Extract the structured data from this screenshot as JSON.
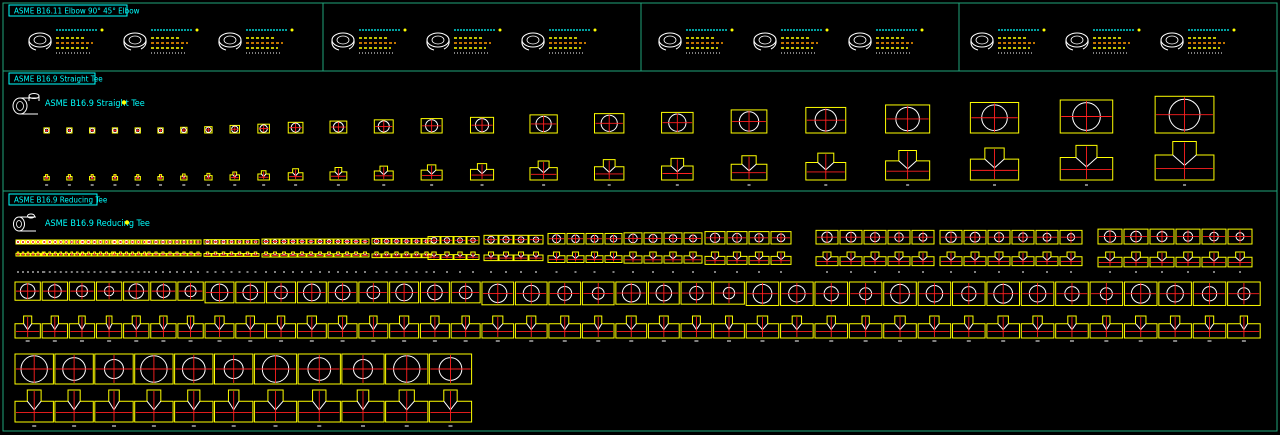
{
  "colors": {
    "background": "#000000",
    "frame": "#21a37a",
    "title": "#00ffff",
    "outline": "#ffff00",
    "detail": "#ffffff",
    "centerline": "#ff2020",
    "accent": "#ff9900"
  },
  "sections": {
    "elbow": {
      "title": "ASME B16.11 Elbow 90° 45° Elbow"
    },
    "straight_tee": {
      "title": "ASME B16.9 Straight Tee",
      "label": "ASME B16.9 Straight Tee",
      "icon": "straight-tee-3d-icon"
    },
    "reducing_tee": {
      "title": "ASME B16.9 Reducing Tee",
      "label": "ASME B16.9 Reducing Tee",
      "icon": "reducing-tee-3d-icon"
    }
  },
  "elbow_icon": "elbow-3d-icon",
  "elbow_groups": [
    {
      "icons": [
        "elbow-3d-icon",
        "elbow-3d-icon",
        "elbow-3d-icon"
      ]
    },
    {
      "icons": [
        "elbow-3d-icon",
        "elbow-3d-icon",
        "elbow-3d-icon"
      ]
    },
    {
      "icons": [
        "elbow-3d-icon",
        "elbow-3d-icon",
        "elbow-3d-icon"
      ]
    },
    {
      "icons": [
        "elbow-3d-icon",
        "elbow-3d-icon",
        "elbow-3d-icon"
      ]
    }
  ]
}
